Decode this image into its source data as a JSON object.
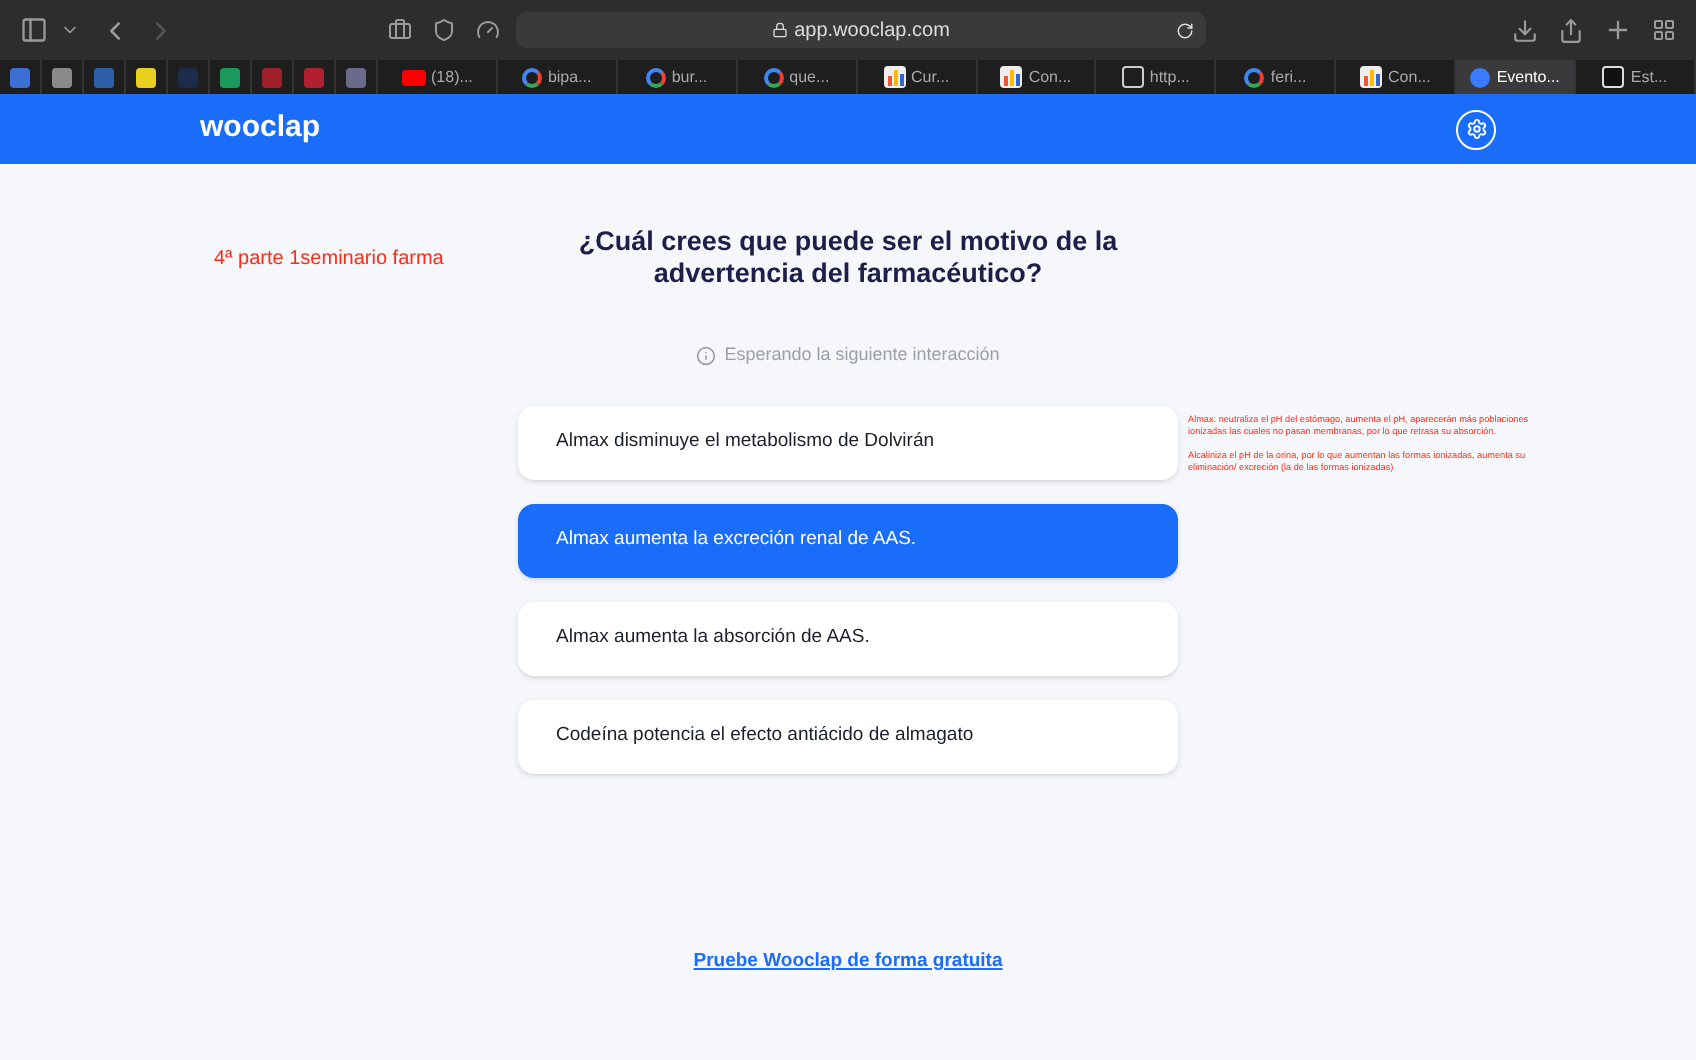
{
  "browser": {
    "url": "app.wooclap.com",
    "pinned_tabs": [
      {
        "color": "#3b6fd6"
      },
      {
        "color": "#8a8a8a"
      },
      {
        "color": "#2c5fa8"
      },
      {
        "color": "#e8d020"
      },
      {
        "color": "#1d2b4a"
      },
      {
        "color": "#1a9a5a"
      },
      {
        "color": "#a0202a"
      },
      {
        "color": "#b02030"
      },
      {
        "color": "#6a6a8a"
      }
    ],
    "tabs": [
      {
        "title": "(18)...",
        "kind": "video",
        "selected": false
      },
      {
        "title": "bipa...",
        "kind": "search",
        "selected": false
      },
      {
        "title": "bur...",
        "kind": "search",
        "selected": false
      },
      {
        "title": "que...",
        "kind": "search",
        "selected": false
      },
      {
        "title": "Cur...",
        "kind": "chart",
        "selected": false
      },
      {
        "title": "Con...",
        "kind": "chart",
        "selected": false
      },
      {
        "title": "http...",
        "kind": "square",
        "selected": false
      },
      {
        "title": "feri...",
        "kind": "search",
        "selected": false
      },
      {
        "title": "Con...",
        "kind": "chart",
        "selected": false
      },
      {
        "title": "Evento...",
        "kind": "dot",
        "selected": true
      },
      {
        "title": "Est...",
        "kind": "blank",
        "selected": false
      }
    ]
  },
  "header": {
    "logo": "wooclap"
  },
  "session_note": "4ª parte 1seminario farma",
  "question": "¿Cuál crees que puede ser el motivo de la advertencia del farmacéutico?",
  "status": "Esperando la siguiente interacción",
  "options": [
    {
      "text": "Almax disminuye el metabolismo de Dolvirán",
      "selected": false
    },
    {
      "text": "Almax aumenta la excreción renal de AAS.",
      "selected": true
    },
    {
      "text": "Almax aumenta la absorción de AAS.",
      "selected": false
    },
    {
      "text": "Codeína potencia el efecto antiácido de almagato",
      "selected": false
    }
  ],
  "annotation": [
    "Almax: neutraliza el pH del estómago, aumenta el pH, aparecerán más poblaciones ionizadas las cuales no pasan membranas, por lo que retrasa su absorción.",
    "Alcaliniza el pH de la orina, por lo que aumentan las formas ionizadas, aumenta su eliminación/ excreción (la de las formas ionizadas)"
  ],
  "footer_link": "Pruebe Wooclap de forma gratuita"
}
